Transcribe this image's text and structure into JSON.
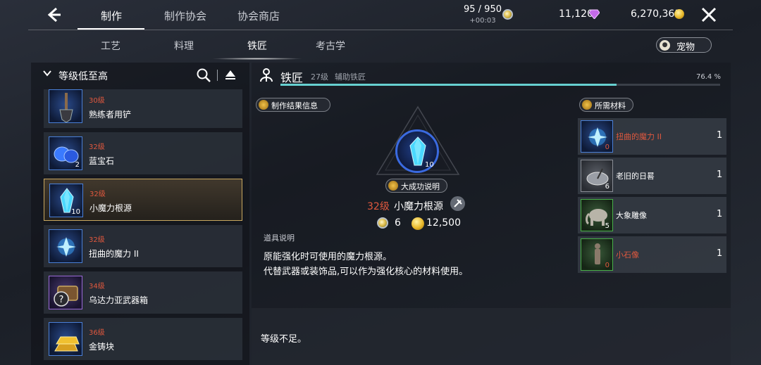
{
  "topbar": {
    "tabs": [
      {
        "label": "制作",
        "active": true
      },
      {
        "label": "制作协会",
        "active": false
      },
      {
        "label": "协会商店",
        "active": false
      }
    ],
    "stamina": {
      "value": "95 / 950",
      "timer": "+00:03",
      "icon": "silver-coin-icon"
    },
    "gems": {
      "value": "11,120",
      "icon": "purple-gem-icon"
    },
    "gold": {
      "value": "6,270,361",
      "icon": "gold-coin-icon"
    }
  },
  "subtabs": [
    {
      "label": "工艺",
      "active": false
    },
    {
      "label": "料理",
      "active": false
    },
    {
      "label": "铁匠",
      "active": true
    },
    {
      "label": "考古学",
      "active": false
    }
  ],
  "pet_button": {
    "label": "宠物",
    "icon": "paw-icon"
  },
  "sort": {
    "label": "等级低至高"
  },
  "recipes": [
    {
      "level": "30级",
      "name": "熟练者用铲",
      "count": "",
      "icon": "shovel-icon",
      "rarity": "blue"
    },
    {
      "level": "32级",
      "name": "蓝宝石",
      "count": "2",
      "icon": "sapphire-icon",
      "rarity": "blue"
    },
    {
      "level": "32级",
      "name": "小魔力根源",
      "count": "10",
      "icon": "mana-crystal-icon",
      "rarity": "blue",
      "selected": true
    },
    {
      "level": "32级",
      "name": "扭曲的魔力 II",
      "count": "",
      "icon": "distorted-mana-icon",
      "rarity": "blue"
    },
    {
      "level": "34级",
      "name": "乌达力亚武器箱",
      "count": "",
      "icon": "weapon-chest-icon",
      "rarity": "purple"
    },
    {
      "level": "36级",
      "name": "金铸块",
      "count": "",
      "icon": "gold-ingot-icon",
      "rarity": "blue"
    }
  ],
  "skill": {
    "name": "铁匠",
    "level": "27级",
    "title": "辅助铁匠",
    "percent": "76.4 %",
    "progress": 0.764,
    "bar_color": "#66d0d0"
  },
  "result": {
    "info_label": "制作结果信息",
    "great_success_label": "大成功说明",
    "count": "10",
    "level": "32级",
    "name": "小魔力根源",
    "cost_silver": "6",
    "cost_gold": "12,500",
    "desc_label": "道具说明",
    "desc_lines": [
      "原能强化时可使用的魔力根源。",
      "代替武器或装饰品,可以作为强化核心的材料使用。"
    ],
    "notice": "等级不足。"
  },
  "materials": {
    "label": "所需材料",
    "items": [
      {
        "name": "扭曲的魔力 II",
        "have": "0",
        "need": "1",
        "insufficient": true,
        "icon": "distorted-mana-icon",
        "rarity": "blue"
      },
      {
        "name": "老旧的日晷",
        "have": "6",
        "need": "1",
        "insufficient": false,
        "icon": "sundial-icon",
        "rarity": "gray"
      },
      {
        "name": "大象雕像",
        "have": "5",
        "need": "1",
        "insufficient": false,
        "icon": "elephant-statue-icon",
        "rarity": "green"
      },
      {
        "name": "小石像",
        "have": "0",
        "need": "1",
        "insufficient": true,
        "icon": "stone-statue-icon",
        "rarity": "green"
      }
    ]
  },
  "colors": {
    "accent_red": "#e0583e",
    "rarity_blue": "#4a80d8",
    "rarity_purple": "#9a6ad8",
    "rarity_green": "#48b048",
    "selected_border": "#c9a860"
  }
}
